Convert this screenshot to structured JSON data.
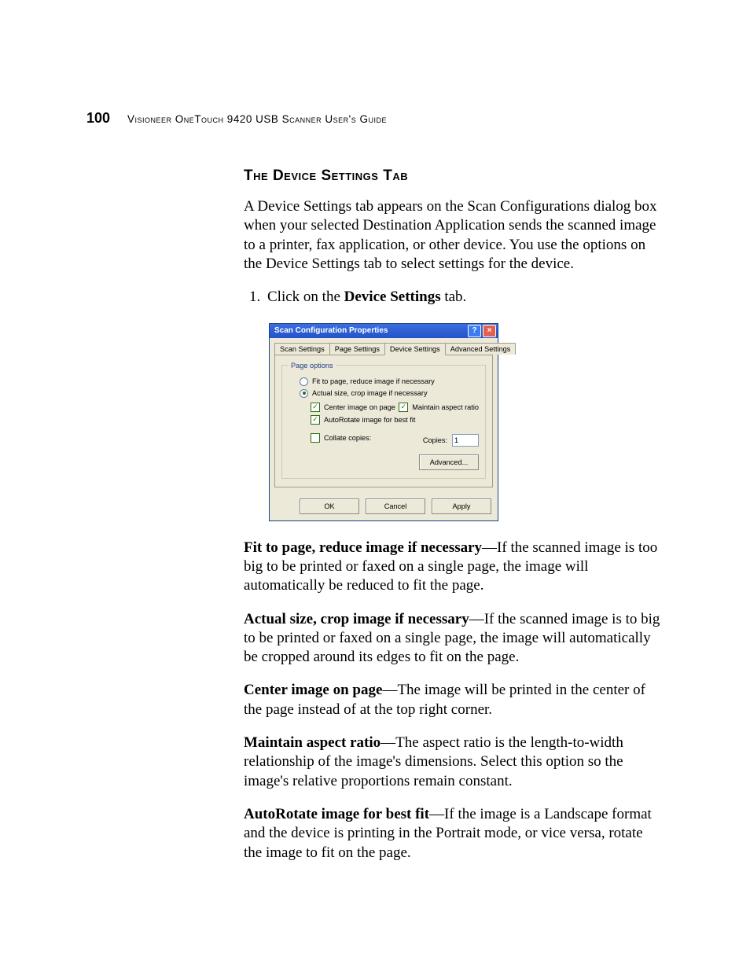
{
  "page_number": "100",
  "running_head": "Visioneer OneTouch 9420 USB Scanner User's Guide",
  "section_heading": "The Device Settings Tab",
  "intro_para": "A Device Settings tab appears on the Scan Configurations dialog box when your selected Destination Application sends the scanned image to a printer, fax application, or other device. You use the options on the Device Settings tab to select settings for the device.",
  "step1_prefix": "Click on the ",
  "step1_bold": "Device Settings",
  "step1_suffix": " tab.",
  "dialog": {
    "title": "Scan Configuration Properties",
    "tabs": {
      "scan": "Scan Settings",
      "page": "Page Settings",
      "device": "Device Settings",
      "advanced": "Advanced Settings"
    },
    "group_legend": "Page options",
    "radio_fit": "Fit to page, reduce image if necessary",
    "radio_actual": "Actual size, crop image if necessary",
    "chk_center": "Center image on page",
    "chk_aspect": "Maintain aspect ratio",
    "chk_autorotate": "AutoRotate image for best fit",
    "chk_collate": "Collate copies:",
    "copies_label": "Copies:",
    "copies_value": "1",
    "advanced_btn": "Advanced...",
    "ok": "OK",
    "cancel": "Cancel",
    "apply": "Apply"
  },
  "desc": {
    "fit_bold": "Fit to page, reduce image if necessary",
    "fit_text": "—If the scanned image is too big to be printed or faxed on a single page, the image will automatically be reduced to fit the page.",
    "actual_bold": "Actual size, crop image if necessary",
    "actual_text": "—If the scanned image is to big to be printed or faxed on a single page, the image will automatically be cropped around its edges to fit on the page.",
    "center_bold": "Center image on page",
    "center_text": "—The image will be printed in the center of the page instead of at the top right corner.",
    "aspect_bold": "Maintain aspect ratio",
    "aspect_text": "—The aspect ratio is the length-to-width relationship of the image's dimensions. Select this option so the image's relative proportions remain constant.",
    "auto_bold": "AutoRotate image for best fit",
    "auto_text": "—If the image is a Landscape format and the device is printing in the Portrait mode, or vice versa, rotate the image to fit on the page."
  }
}
